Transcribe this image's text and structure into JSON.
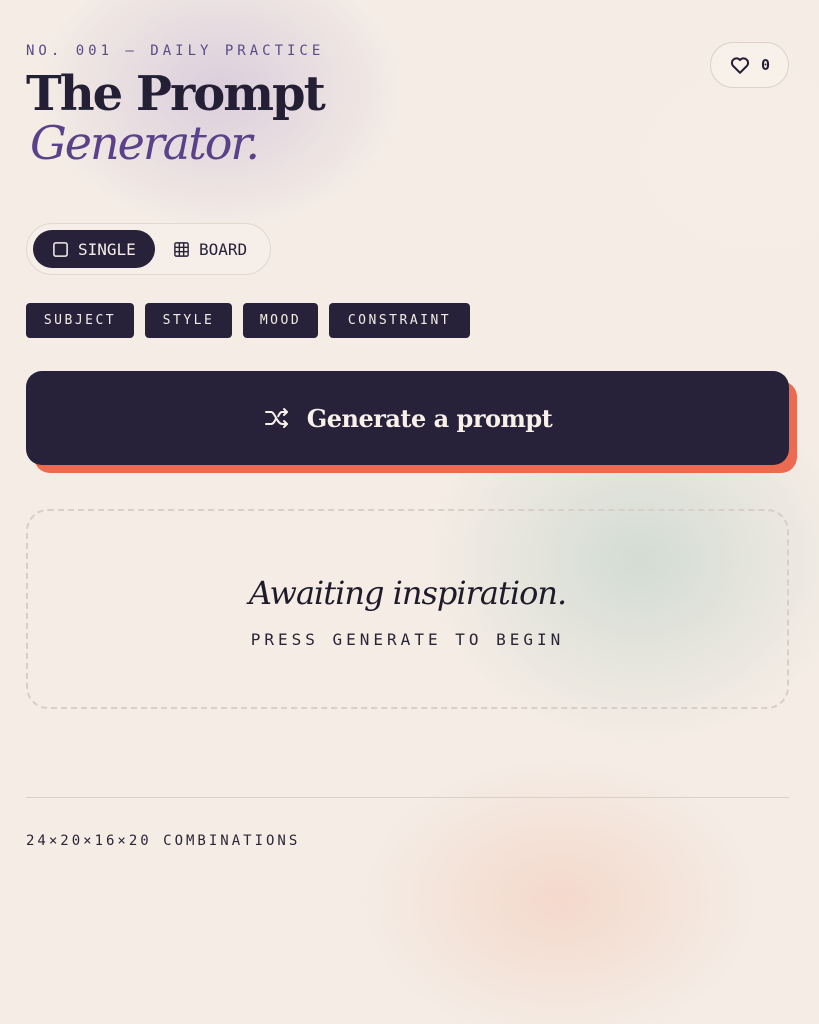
{
  "header": {
    "kicker": "NO. 001 — DAILY PRACTICE",
    "title_line1": "The Prompt",
    "title_line2": "Generator."
  },
  "like": {
    "icon": "heart-icon",
    "count": "0"
  },
  "mode_toggle": {
    "options": [
      {
        "label": "SINGLE",
        "icon": "square-icon",
        "selected": true
      },
      {
        "label": "BOARD",
        "icon": "grid-icon",
        "selected": false
      }
    ]
  },
  "categories": [
    {
      "label": "SUBJECT"
    },
    {
      "label": "STYLE"
    },
    {
      "label": "MOOD"
    },
    {
      "label": "CONSTRAINT"
    }
  ],
  "generate_button": {
    "icon": "shuffle-icon",
    "label": "Generate a prompt"
  },
  "result": {
    "title": "Awaiting inspiration.",
    "subtitle": "PRESS GENERATE TO BEGIN"
  },
  "footer": {
    "combinations": "24×20×16×20 COMBINATIONS"
  },
  "colors": {
    "ink": "#27223a",
    "accent": "#5a4188",
    "shadow_accent": "#ec6b50",
    "background": "#f4ece5"
  }
}
